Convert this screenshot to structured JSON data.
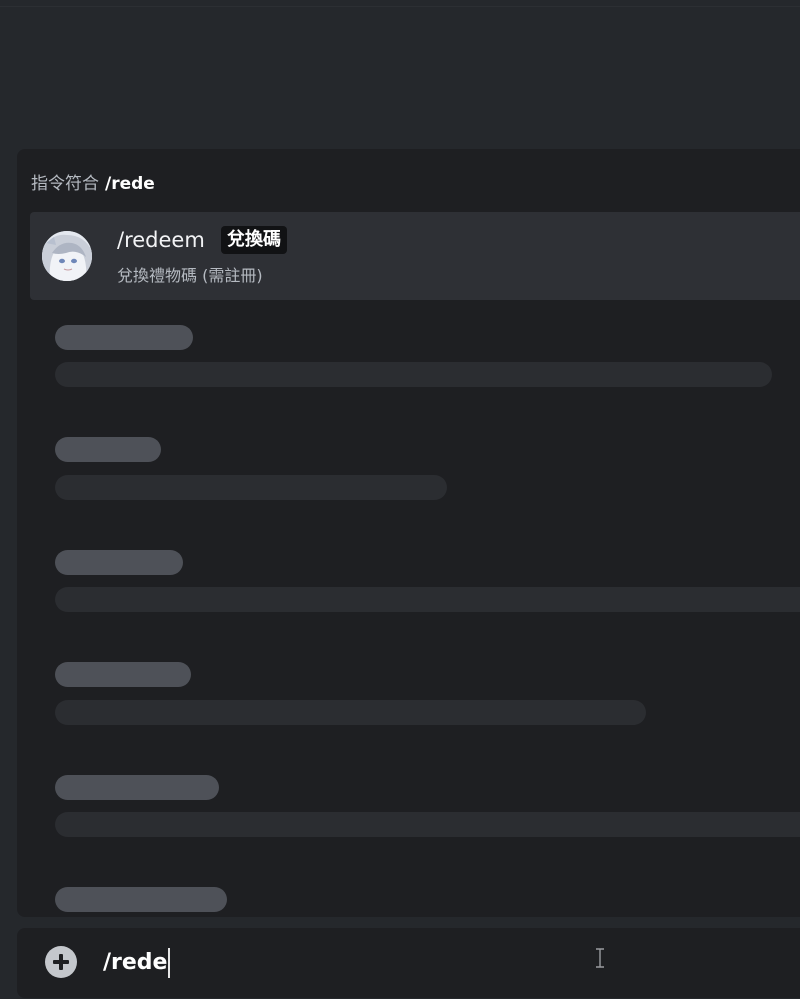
{
  "autocomplete": {
    "header_label": "指令符合",
    "query": "/rede",
    "command": {
      "name": "/redeem",
      "badge": "兌換碼",
      "description": "兌換禮物碼 (需註冊)",
      "avatar_icon": "bot-avatar"
    },
    "loading_placeholders": 6
  },
  "composer": {
    "add_icon": "plus-circle-icon",
    "value": "/rede",
    "cursor_icon": "text-cursor-icon"
  },
  "colors": {
    "background": "#25282c",
    "panel": "#1e1f22",
    "selected_row": "#2e3035",
    "skeleton_title": "#4e5158",
    "skeleton_line": "#2b2d31"
  }
}
